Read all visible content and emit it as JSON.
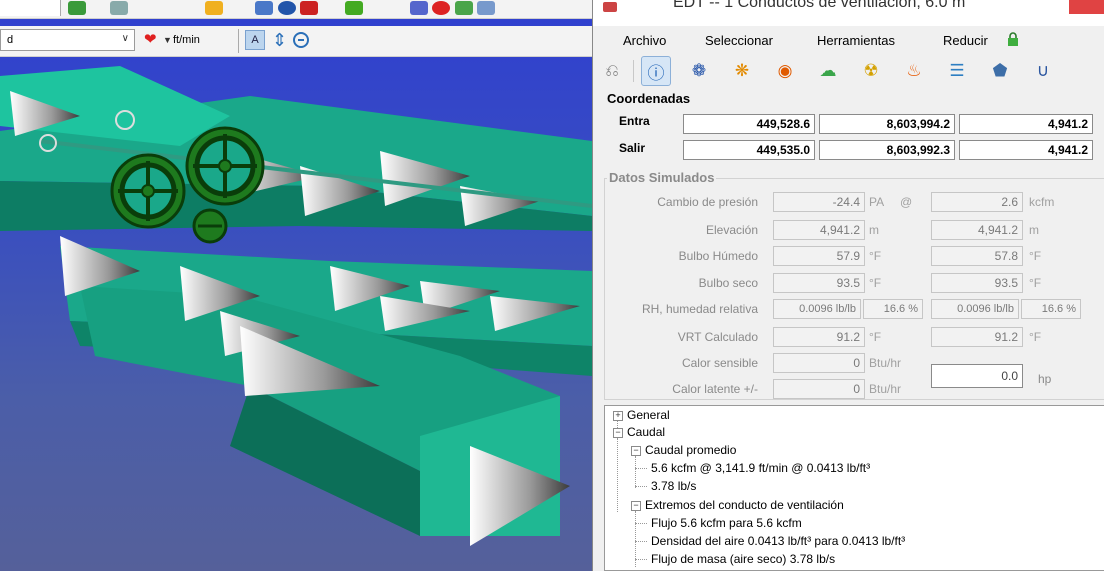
{
  "viewport": {
    "dropdown_value": "d",
    "unit": "ft/min",
    "colors": {
      "duct": "#1aa88a",
      "sky": "#3a4fbf",
      "fan": "#1e7a1e"
    }
  },
  "dialog": {
    "title": "EDT -- 1 Conductos de ventilación, 6.0 m",
    "menu": [
      "Archivo",
      "Seleccionar",
      "Herramientas",
      "Reducir"
    ],
    "coords": {
      "title": "Coordenadas",
      "rows": [
        {
          "label": "Entra",
          "x": "449,528.6",
          "y": "8,603,994.2",
          "z": "4,941.2"
        },
        {
          "label": "Salir",
          "x": "449,535.0",
          "y": "8,603,992.3",
          "z": "4,941.2"
        }
      ]
    },
    "datos": {
      "title": "Datos Simulados",
      "pressure": {
        "label": "Cambio de presión",
        "value": "-24.4",
        "unit": "PA",
        "at": "@",
        "flow": "2.6",
        "flow_unit": "kcfm"
      },
      "elevation": {
        "label": "Elevación",
        "v1": "4,941.2",
        "u1": "m",
        "v2": "4,941.2",
        "u2": "m"
      },
      "wet_bulb": {
        "label": "Bulbo Húmedo",
        "v1": "57.9",
        "u1": "°F",
        "v2": "57.8",
        "u2": "°F"
      },
      "dry_bulb": {
        "label": "Bulbo seco",
        "v1": "93.5",
        "u1": "°F",
        "v2": "93.5",
        "u2": "°F"
      },
      "rh": {
        "label": "RH, humedad relativa",
        "a1": "0.0096 lb/lb",
        "b1": "16.6 %",
        "a2": "0.0096 lb/lb",
        "b2": "16.6 %"
      },
      "vrt": {
        "label": "VRT Calculado",
        "v1": "91.2",
        "u1": "°F",
        "v2": "91.2",
        "u2": "°F"
      },
      "sensible": {
        "label": "Calor sensible",
        "value": "0",
        "unit": "Btu/hr"
      },
      "latent": {
        "label": "Calor latente +/-",
        "value": "0",
        "unit": "Btu/hr"
      },
      "power": {
        "value": "0.0",
        "unit": "hp"
      }
    },
    "tree": {
      "general": "General",
      "caudal": "Caudal",
      "caudal_promedio": "Caudal promedio",
      "cp_line1": "5.6 kcfm  @  3,141.9 ft/min  @  0.0413 lb/ft³",
      "cp_line2": "3.78 lb/s",
      "extremos": "Extremos del conducto de ventilación",
      "ext_line1": "Flujo    5.6 kcfm  para 5.6 kcfm",
      "ext_line2": "Densidad del aire 0.0413 lb/ft³  para 0.0413 lb/ft³",
      "ext_line3": "Flujo de masa (aire seco)  3.78 lb/s"
    }
  }
}
